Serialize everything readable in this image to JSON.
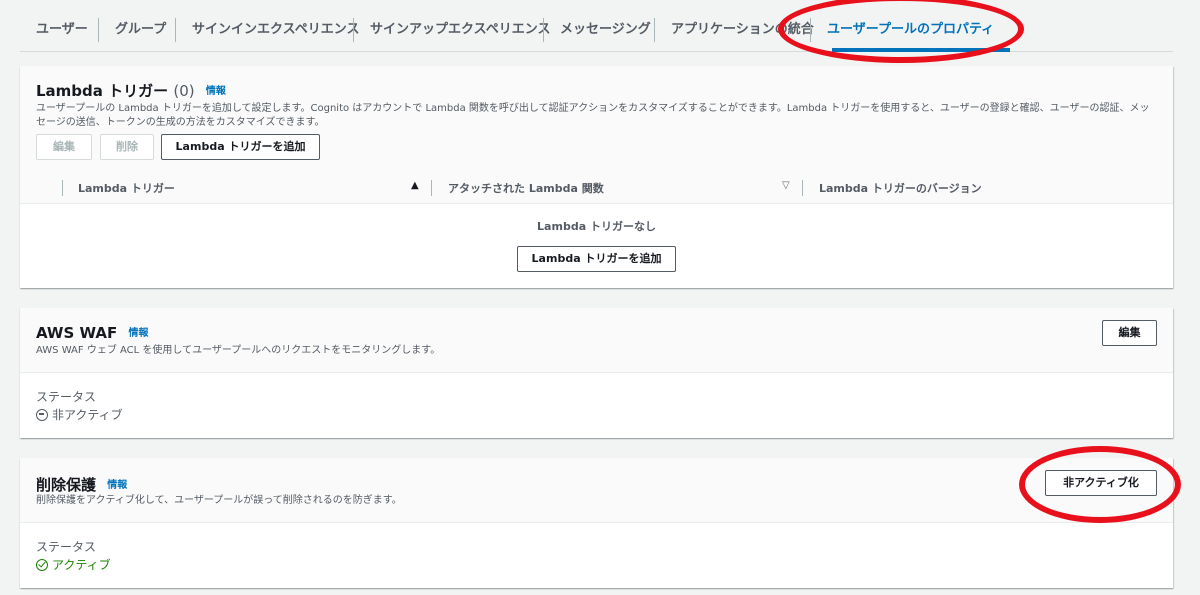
{
  "tabs": [
    {
      "label": "ユーザー"
    },
    {
      "label": "グループ"
    },
    {
      "label": "サインインエクスペリエンス"
    },
    {
      "label": "サインアップエクスペリエンス"
    },
    {
      "label": "メッセージング"
    },
    {
      "label": "アプリケーションの統合"
    },
    {
      "label": "ユーザープールのプロパティ",
      "active": true
    }
  ],
  "lambda": {
    "title": "Lambda トリガー",
    "count": "(0)",
    "info": "情報",
    "description": "ユーザープールの Lambda トリガーを追加して設定します。Cognito はアカウントで Lambda 関数を呼び出して認証アクションをカスタマイズすることができます。Lambda トリガーを使用すると、ユーザーの登録と確認、ユーザーの認証、メッセージの送信、トークンの生成の方法をカスタマイズできます。",
    "edit_label": "編集",
    "delete_label": "削除",
    "add_label": "Lambda トリガーを追加",
    "columns": [
      "Lambda トリガー",
      "アタッチされた Lambda 関数",
      "Lambda トリガーのバージョン"
    ],
    "empty_text": "Lambda トリガーなし",
    "empty_add_label": "Lambda トリガーを追加"
  },
  "waf": {
    "title": "AWS WAF",
    "info": "情報",
    "description": "AWS WAF ウェブ ACL を使用してユーザープールへのリクエストをモニタリングします。",
    "edit_label": "編集",
    "status_label": "ステータス",
    "status_value": "非アクティブ"
  },
  "deletion": {
    "title": "削除保護",
    "info": "情報",
    "description": "削除保護をアクティブ化して、ユーザープールが誤って削除されるのを防ぎます。",
    "deactivate_label": "非アクティブ化",
    "status_label": "ステータス",
    "status_value": "アクティブ"
  },
  "colors": {
    "accent": "#0073bb",
    "active_status": "#1d8102",
    "inactive_status": "#545b64",
    "annotation": "#e8101a"
  },
  "icons": {
    "sort_asc": "sort-ascending-icon",
    "sort_desc": "sort-descending-icon",
    "inactive": "minus-circle-icon",
    "active": "check-circle-icon"
  }
}
